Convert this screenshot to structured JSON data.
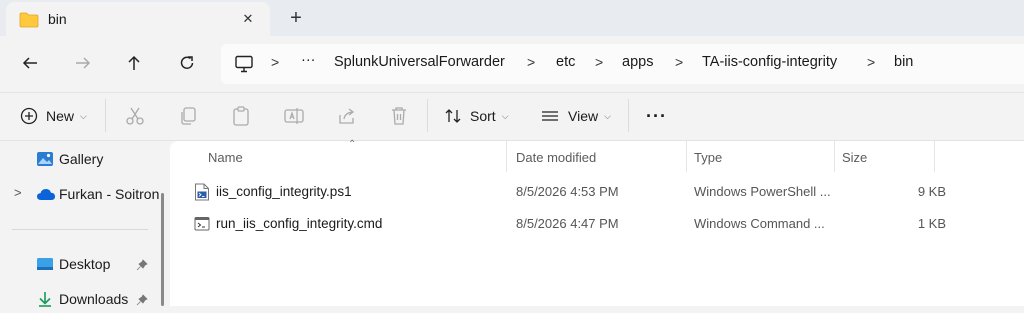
{
  "window": {
    "tab_title": "bin",
    "close_glyph": "✕",
    "new_tab_glyph": "+"
  },
  "address": {
    "more_glyph": "···",
    "crumbs": [
      "SplunkUniversalForwarder",
      "etc",
      "apps",
      "TA-iis-config-integrity",
      "bin"
    ]
  },
  "toolbar": {
    "new_label": "New",
    "sort_label": "Sort",
    "view_label": "View",
    "more_glyph": "···"
  },
  "sidebar": {
    "items": [
      {
        "label": "Gallery",
        "icon": "gallery-icon"
      },
      {
        "label": "Furkan - Soitron",
        "icon": "onedrive-cloud-icon"
      },
      {
        "label": "Desktop",
        "icon": "desktop-icon",
        "pinned": true
      },
      {
        "label": "Downloads",
        "icon": "download-arrow-icon",
        "pinned": true
      }
    ]
  },
  "columns": {
    "name": "Name",
    "date": "Date modified",
    "type": "Type",
    "size": "Size"
  },
  "files": [
    {
      "name": "iis_config_integrity.ps1",
      "date": "8/5/2026 4:53 PM",
      "type": "Windows PowerShell ...",
      "size": "9 KB",
      "icon": "powershell-script-icon"
    },
    {
      "name": "run_iis_config_integrity.cmd",
      "date": "8/5/2026 4:47 PM",
      "type": "Windows Command ...",
      "size": "1 KB",
      "icon": "cmd-script-icon"
    }
  ],
  "colors": {
    "accent": "#0067c0",
    "folder": "#ffc83d",
    "onedrive": "#0a64d8"
  }
}
